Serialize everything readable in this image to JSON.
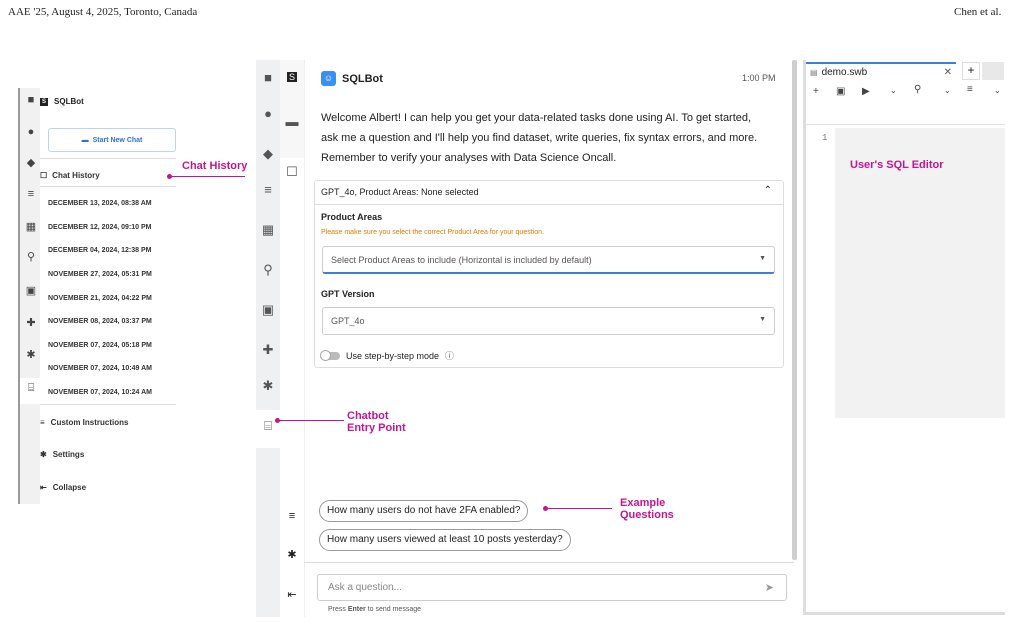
{
  "header": {
    "left": "AAE '25, August 4, 2025, Toronto, Canada",
    "right": "Chen et al."
  },
  "left_panel": {
    "app_name": "SQLBot",
    "start_new_chat": "Start New Chat",
    "chat_history_label": "Chat History",
    "history": [
      "DECEMBER 13, 2024, 08:38 AM",
      "DECEMBER 12, 2024, 09:10 PM",
      "DECEMBER 04, 2024, 12:38 PM",
      "NOVEMBER 27, 2024, 05:31 PM",
      "NOVEMBER 21, 2024, 04:22 PM",
      "NOVEMBER 08, 2024, 03:37 PM",
      "NOVEMBER 07, 2024, 05:18 PM",
      "NOVEMBER 07, 2024, 10:49 AM",
      "NOVEMBER 07, 2024, 10:24 AM"
    ],
    "custom_instructions": "Custom Instructions",
    "settings": "Settings",
    "collapse": "Collapse"
  },
  "annotations": {
    "chat_history": "Chat History",
    "chatbot_entry_1": "Chatbot",
    "chatbot_entry_2": "Entry Point",
    "example_1": "Example",
    "example_2": "Questions",
    "sql_editor": "User's SQL Editor"
  },
  "chat": {
    "bot_name": "SQLBot",
    "time": "1:00 PM",
    "welcome": "Welcome Albert! I can help you get your data-related tasks done using AI. To get started, ask me a question and I'll help you find dataset, write queries, fix syntax errors, and more. Remember to verify your analyses with Data Science Oncall.",
    "settings_summary": "GPT_4o, Product Areas: None selected",
    "product_areas_label": "Product Areas",
    "product_areas_warning": "Please make sure you select the correct Product Area for your question.",
    "product_areas_placeholder": "Select Product Areas to include (Horizontal is included by default)",
    "gpt_version_label": "GPT Version",
    "gpt_version_value": "GPT_4o",
    "step_mode_label": "Use step-by-step mode",
    "example_questions": [
      "How many users do not have 2FA enabled?",
      "How many users viewed at least 10 posts yesterday?"
    ],
    "ask_placeholder": "Ask a question...",
    "hint_pre": "Press ",
    "hint_key": "Enter",
    "hint_post": " to send message"
  },
  "editor": {
    "tab_name": "demo.swb",
    "line_number": "1"
  },
  "colors": {
    "annotation": "#c4158f",
    "accent": "#2f6fd6",
    "warning": "#e07b00"
  }
}
